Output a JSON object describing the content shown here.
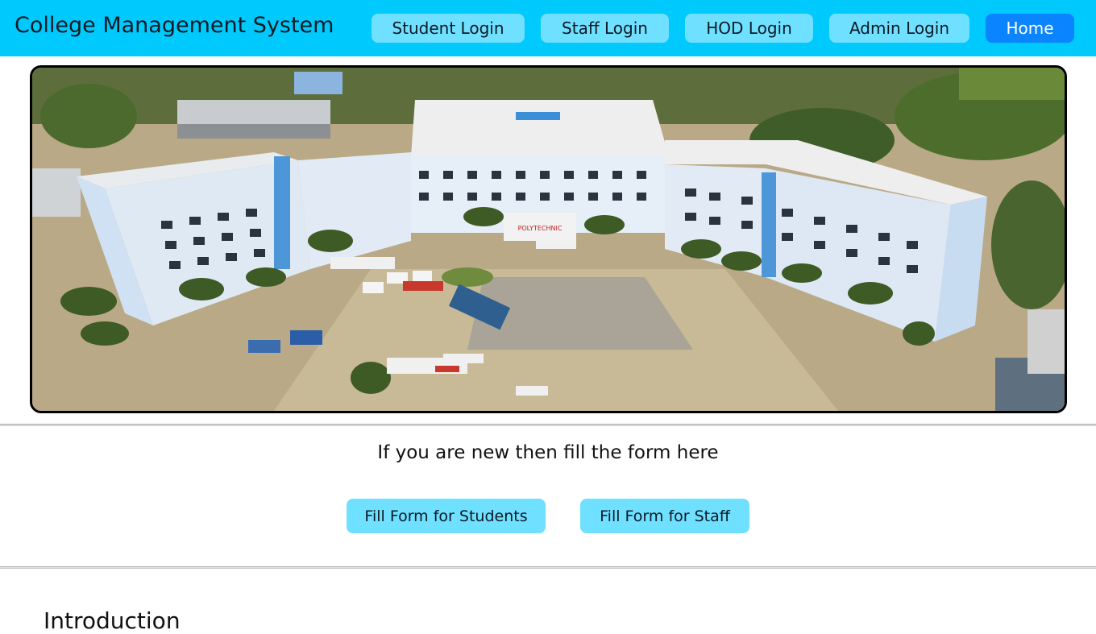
{
  "header": {
    "title": "College Management System",
    "nav": [
      {
        "label": "Student Login"
      },
      {
        "label": "Staff Login"
      },
      {
        "label": "HOD Login"
      },
      {
        "label": "Admin Login"
      },
      {
        "label": "Home"
      }
    ]
  },
  "hero": {
    "building_sign": "POLYTECHNIC"
  },
  "signup": {
    "prompt": "If you are new then fill the form here",
    "student_button": "Fill Form for Students",
    "staff_button": "Fill Form for Staff"
  },
  "intro": {
    "heading": "Introduction"
  },
  "colors": {
    "header_bg": "#00cafd",
    "button_bg": "#6fe0ff",
    "home_button_bg": "#0a85ff"
  }
}
